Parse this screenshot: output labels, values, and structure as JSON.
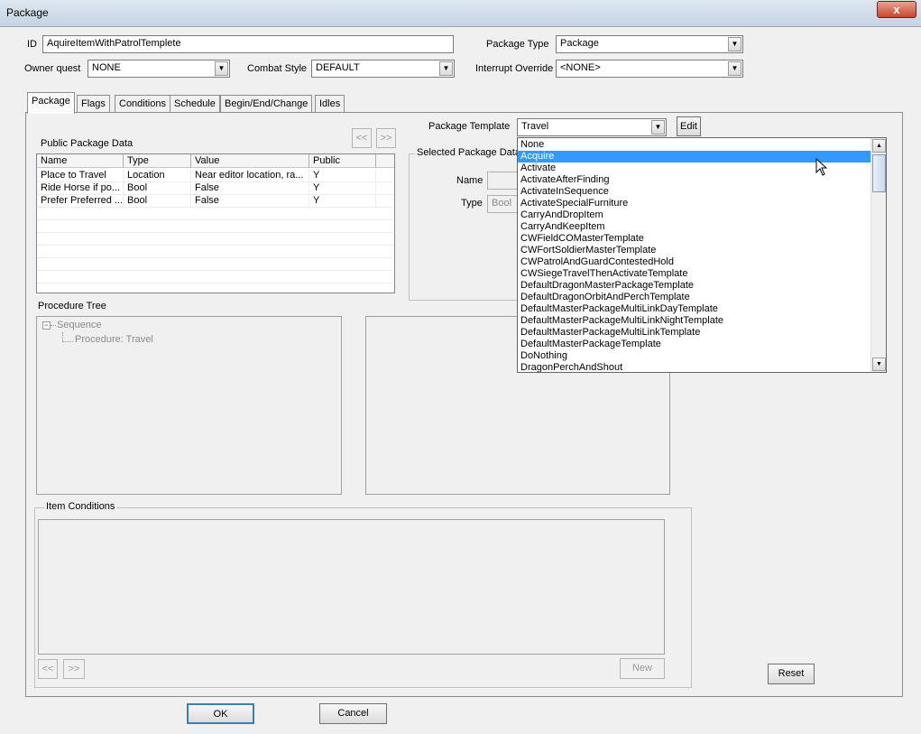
{
  "window": {
    "title": "Package",
    "close_label": "x"
  },
  "fields": {
    "id_label": "ID",
    "id_value": "AquireItemWithPatrolTemplete",
    "package_type_label": "Package Type",
    "package_type_value": "Package",
    "owner_quest_label": "Owner quest",
    "owner_quest_value": "NONE",
    "combat_style_label": "Combat Style",
    "combat_style_value": "DEFAULT",
    "interrupt_override_label": "Interrupt Override",
    "interrupt_override_value": "<NONE>"
  },
  "tabs": [
    {
      "label": "Package"
    },
    {
      "label": "Flags"
    },
    {
      "label": "Conditions"
    },
    {
      "label": "Schedule"
    },
    {
      "label": "Begin/End/Change"
    },
    {
      "label": "Idles"
    }
  ],
  "public_data": {
    "title": "Public Package Data",
    "prev_label": "<<",
    "next_label": ">>",
    "columns": [
      "Name",
      "Type",
      "Value",
      "Public"
    ],
    "rows": [
      {
        "name": "Place to Travel",
        "type": "Location",
        "value": "Near editor location, ra...",
        "public": "Y"
      },
      {
        "name": "Ride Horse if po...",
        "type": "Bool",
        "value": "False",
        "public": "Y"
      },
      {
        "name": "Prefer Preferred ...",
        "type": "Bool",
        "value": "False",
        "public": "Y"
      }
    ]
  },
  "template": {
    "label": "Package Template",
    "value": "Travel",
    "edit_label": "Edit",
    "selected_group_title": "Selected Package Data",
    "name_label": "Name",
    "type_label": "Type",
    "type_value": "Bool",
    "dropdown_items": [
      "None",
      "Acquire",
      "Activate",
      "ActivateAfterFinding",
      "ActivateInSequence",
      "ActivateSpecialFurniture",
      "CarryAndDropItem",
      "CarryAndKeepItem",
      "CWFieldCOMasterTemplate",
      "CWFortSoldierMasterTemplate",
      "CWPatrolAndGuardContestedHold",
      "CWSiegeTravelThenActivateTemplate",
      "DefaultDragonMasterPackageTemplate",
      "DefaultDragonOrbitAndPerchTemplate",
      "DefaultMasterPackageMultiLinkDayTemplate",
      "DefaultMasterPackageMultiLinkNightTemplate",
      "DefaultMasterPackageMultiLinkTemplate",
      "DefaultMasterPackageTemplate",
      "DoNothing",
      "DragonPerchAndShout"
    ],
    "selected_item": "Acquire"
  },
  "procedure_tree": {
    "title": "Procedure Tree",
    "root": "Sequence",
    "child": "Procedure: Travel"
  },
  "item_conditions": {
    "title": "Item Conditions",
    "prev_label": "<<",
    "next_label": ">>",
    "new_label": "New"
  },
  "buttons": {
    "reset": "Reset",
    "ok": "OK",
    "cancel": "Cancel"
  }
}
